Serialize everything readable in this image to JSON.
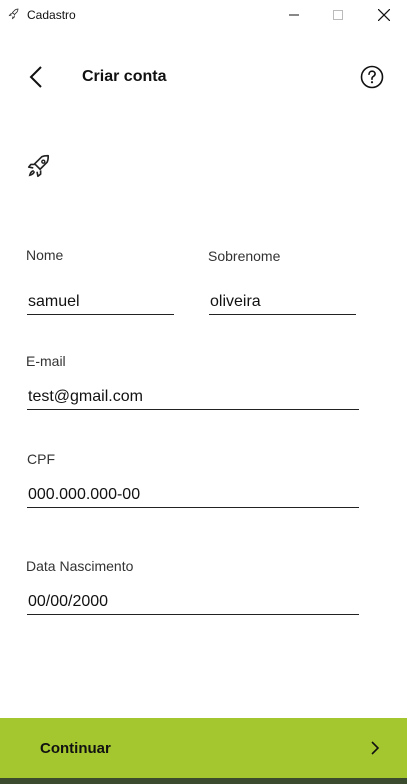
{
  "window": {
    "title": "Cadastro"
  },
  "header": {
    "title": "Criar conta"
  },
  "form": {
    "nome": {
      "label": "Nome",
      "value": "samuel"
    },
    "sobrenome": {
      "label": "Sobrenome",
      "value": "oliveira"
    },
    "email": {
      "label": "E-mail",
      "value": "test@gmail.com"
    },
    "cpf": {
      "label": "CPF",
      "value": "000.000.000-00"
    },
    "nascimento": {
      "label": "Data Nascimento",
      "value": "00/00/2000"
    }
  },
  "footer": {
    "button_label": "Continuar"
  },
  "icons": {
    "back": "chevron-left-icon",
    "help": "help-icon",
    "logo": "rocket-icon",
    "continue": "chevron-right-icon"
  },
  "colors": {
    "accent": "#a4c730"
  }
}
